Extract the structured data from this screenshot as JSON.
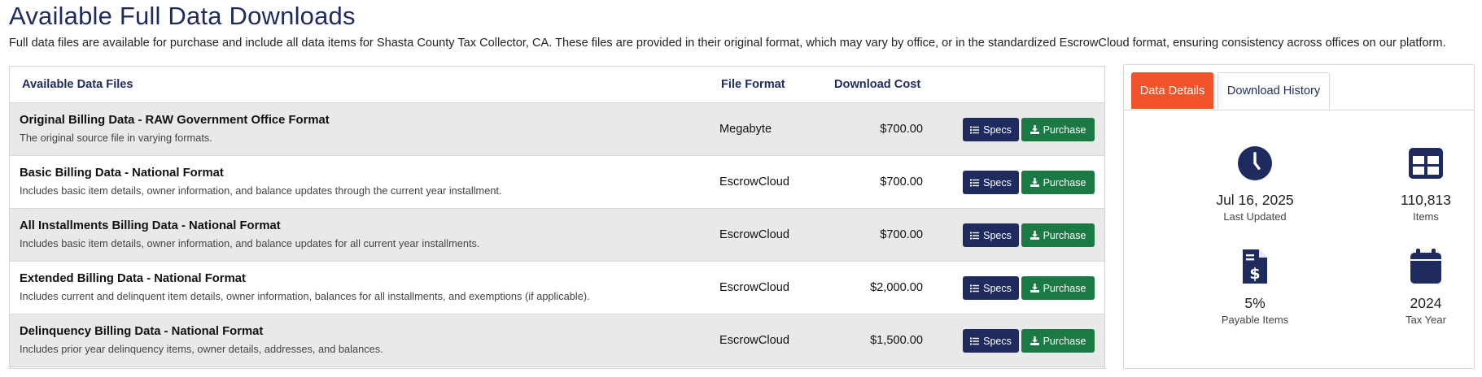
{
  "page": {
    "title": "Available Full Data Downloads",
    "intro": "Full data files are available for purchase and include all data items for Shasta County Tax Collector, CA. These files are provided in their original format, which may vary by office, or in the standardized EscrowCloud format, ensuring consistency across offices on our platform."
  },
  "table": {
    "headers": {
      "files": "Available Data Files",
      "format": "File Format",
      "cost": "Download Cost"
    },
    "rows": [
      {
        "title": "Original Billing Data - RAW Government Office Format",
        "description": "The original source file in varying formats.",
        "format": "Megabyte",
        "cost": "$700.00",
        "specs_label": "Specs",
        "purchase_label": "Purchase"
      },
      {
        "title": "Basic Billing Data - National Format",
        "description": "Includes basic item details, owner information, and balance updates through the current year installment.",
        "format": "EscrowCloud",
        "cost": "$700.00",
        "specs_label": "Specs",
        "purchase_label": "Purchase"
      },
      {
        "title": "All Installments Billing Data - National Format",
        "description": "Includes basic item details, owner information, and balance updates for all current year installments.",
        "format": "EscrowCloud",
        "cost": "$700.00",
        "specs_label": "Specs",
        "purchase_label": "Purchase"
      },
      {
        "title": "Extended Billing Data - National Format",
        "description": "Includes current and delinquent item details, owner information, balances for all installments, and exemptions (if applicable).",
        "format": "EscrowCloud",
        "cost": "$2,000.00",
        "specs_label": "Specs",
        "purchase_label": "Purchase"
      },
      {
        "title": "Delinquency Billing Data - National Format",
        "description": "Includes prior year delinquency items, owner details, addresses, and balances.",
        "format": "EscrowCloud",
        "cost": "$1,500.00",
        "specs_label": "Specs",
        "purchase_label": "Purchase"
      }
    ]
  },
  "side": {
    "tabs": {
      "active": "Data Details",
      "inactive": "Download History"
    },
    "stats": {
      "updated": {
        "value": "Jul 16, 2025",
        "label": "Last Updated",
        "icon": "clock-icon"
      },
      "items": {
        "value": "110,813",
        "label": "Items",
        "icon": "table-icon"
      },
      "payable": {
        "value": "5%",
        "label": "Payable Items",
        "icon": "invoice-dollar-icon"
      },
      "year": {
        "value": "2024",
        "label": "Tax Year",
        "icon": "calendar-icon"
      }
    }
  },
  "colors": {
    "navy": "#1f2b5e",
    "green": "#1b7a44",
    "orange": "#f1542a",
    "row_shade": "#e9e9e9"
  }
}
